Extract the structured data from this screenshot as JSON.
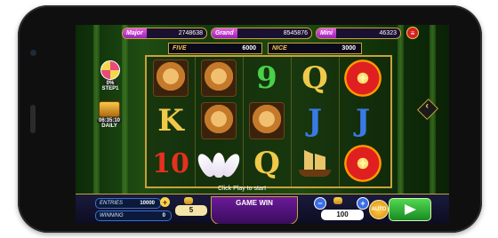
{
  "jackpots": [
    {
      "label": "Major",
      "value": "2748638"
    },
    {
      "label": "Grand",
      "value": "8545876"
    },
    {
      "label": "Mini",
      "value": "46323"
    }
  ],
  "bonus": [
    {
      "label": "FIVE",
      "value": "6000"
    },
    {
      "label": "NICE",
      "value": "3000"
    }
  ],
  "reels": [
    [
      "tiger",
      "K",
      "10"
    ],
    [
      "tiger",
      "tiger",
      "lotus"
    ],
    [
      "9",
      "tiger",
      "Q"
    ],
    [
      "Q",
      "J",
      "junk"
    ],
    [
      "gold-emblem",
      "J",
      "gold-emblem"
    ]
  ],
  "left_panel": {
    "wheel_percent": "0%",
    "step_label": "STEP1",
    "timer": "06:35:10",
    "daily_label": "DAILY"
  },
  "status": "Click Play to start",
  "bottom": {
    "entries_label": "ENTRIES",
    "entries_value": "10000",
    "winning_label": "WINNING",
    "winning_value": "0",
    "lines_value": "5",
    "game_win_label": "GAME WIN",
    "bet_value": "100",
    "auto_label": "AUTO"
  },
  "colors": {
    "gold": "#c9a23a",
    "play_green": "#2fb83a",
    "jackpot_purple": "#9a23b6"
  }
}
